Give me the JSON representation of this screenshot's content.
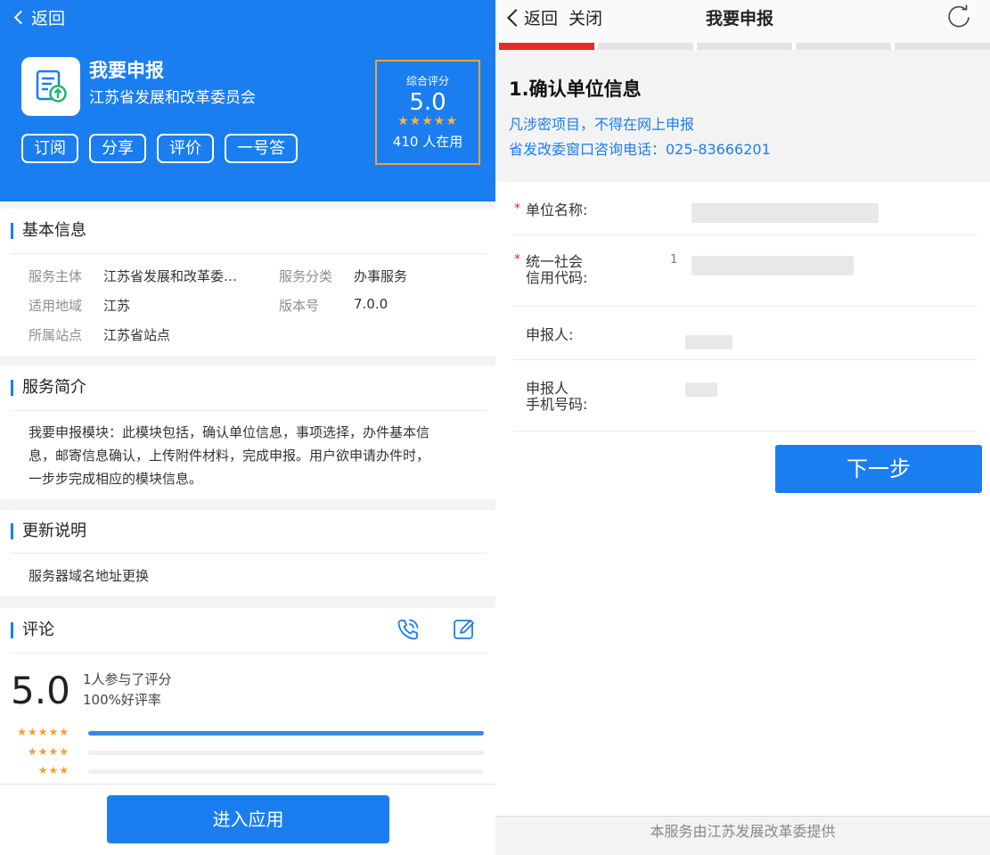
{
  "left": {
    "header": {
      "back_label": "返回"
    },
    "app": {
      "name": "我要申报",
      "org": "江苏省发展和改革委员会",
      "icon": "document-upload-icon",
      "buttons": [
        "订阅",
        "分享",
        "评价",
        "一号答"
      ]
    },
    "score": {
      "title": "综合评分",
      "value": "5.0",
      "stars": "★★★★★",
      "rating_fraction": 1.0,
      "users": "410 人在用"
    },
    "basic": {
      "title": "基本信息",
      "rows": [
        {
          "label": "服务主体",
          "value": "江苏省发展和改革委…",
          "label2": "服务分类",
          "value2": "办事服务"
        },
        {
          "label": "适用地域",
          "value": "江苏",
          "label2": "版本号",
          "value2": "7.0.0"
        },
        {
          "label": "所属站点",
          "value": "江苏省站点"
        }
      ]
    },
    "intro": {
      "title": "服务简介",
      "lines": [
        "我要申报模块：此模块包括，确认单位信息，事项选择，办件基本信",
        "息，邮寄信息确认，上传附件材料，完成申报。用户欲申请办件时，",
        "一步步完成相应的模块信息。"
      ]
    },
    "update": {
      "title": "更新说明",
      "text": "服务器域名地址更换"
    },
    "comments": {
      "title": "评论",
      "icons": [
        "phone-icon",
        "edit-icon"
      ],
      "score": "5.0",
      "participants": "1人参与了评分",
      "good_rate": "100%好评率",
      "bars": [
        {
          "stars": "★★★★★",
          "fraction": 1.0
        },
        {
          "stars": "★★★★",
          "fraction": 0.0
        },
        {
          "stars": "★★★",
          "fraction": 0.0
        }
      ]
    },
    "enter_button": "进入应用"
  },
  "right": {
    "topbar": {
      "back_label": "返回",
      "close_label": "关闭",
      "title": "我要申报",
      "refresh_icon": "refresh-icon"
    },
    "steps": {
      "total": 5,
      "current": 1
    },
    "section": {
      "title": "1.确认单位信息",
      "notes": [
        "凡涉密项目，不得在网上申报",
        "省发改委窗口咨询电话：025-83666201"
      ]
    },
    "form": {
      "unit_name_label": "单位名称:",
      "credit_code_label_1": "统一社会",
      "credit_code_label_2": "信用代码:",
      "applicant_label": "申报人:",
      "phone_label_1": "申报人",
      "phone_label_2": "手机号码:",
      "credit_code_prefix": "1",
      "required_mark": "*"
    },
    "next_button": "下一步",
    "footer": "本服务由江苏发展改革委提供"
  },
  "colors": {
    "primary": "#1a7ef0",
    "accent_red": "#e52b2b",
    "star": "#ffb13a",
    "score_border": "#f0a23a"
  }
}
